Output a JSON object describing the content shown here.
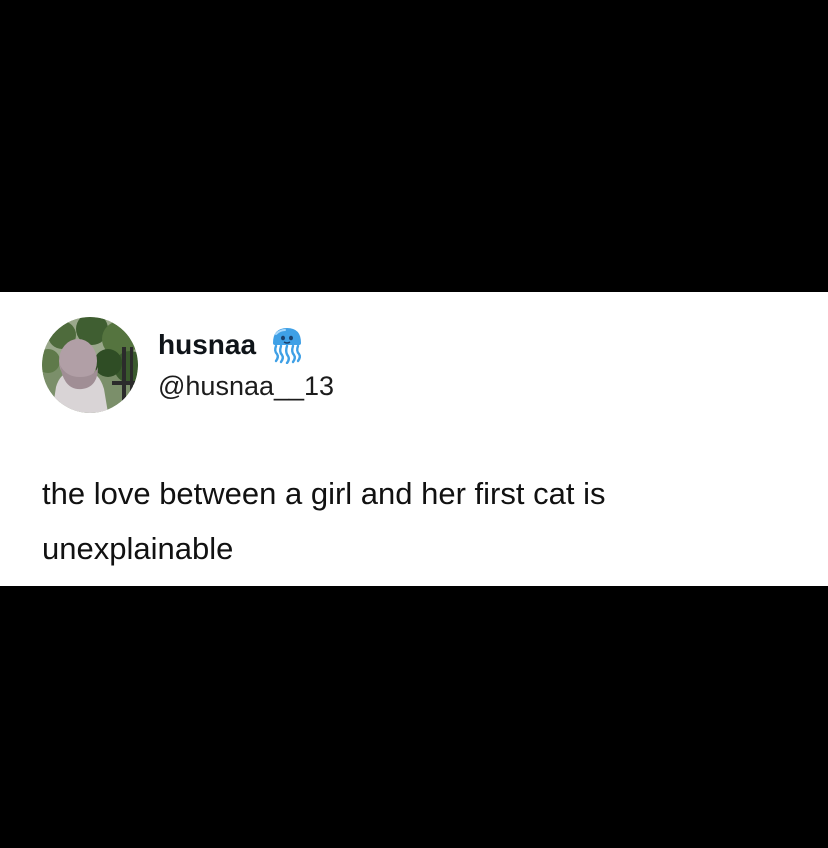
{
  "post": {
    "author": {
      "display_name": "husnaa",
      "handle": "@husnaa__13",
      "badge_icon": "jellyfish-icon"
    },
    "text": "the love between a girl and her first cat is unexplainable"
  },
  "colors": {
    "background": "#000000",
    "card": "#ffffff",
    "badge": "#3fa0e6"
  }
}
